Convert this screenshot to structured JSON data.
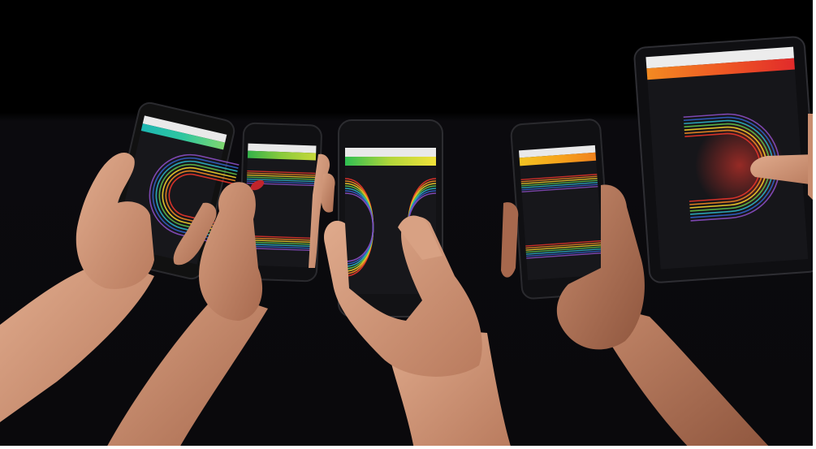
{
  "scene": {
    "background_top": "#000000",
    "background_bottom": "#0c0b10",
    "skin_colors": [
      "#d9a182",
      "#c98e70",
      "#b87a5e",
      "#a8684d"
    ],
    "nail_polish": "#c1242b"
  },
  "devices": [
    {
      "kind": "phone",
      "bar_gradient": [
        "#1db6b3",
        "#2ec7a0",
        "#7fd66e"
      ]
    },
    {
      "kind": "phone",
      "bar_gradient": [
        "#34b24a",
        "#8acb3c",
        "#c7d83a"
      ]
    },
    {
      "kind": "phone",
      "bar_gradient": [
        "#2fbf52",
        "#b3d63a",
        "#f1e23a"
      ]
    },
    {
      "kind": "phone",
      "bar_gradient": [
        "#f2c323",
        "#f7a51c",
        "#f0821d"
      ]
    },
    {
      "kind": "tablet",
      "bar_gradient": [
        "#f28a22",
        "#ef5a24",
        "#e12a2a"
      ]
    }
  ],
  "rainbow": [
    "#e8342b",
    "#f08a24",
    "#f3d12a",
    "#5fc049",
    "#2bb3c6",
    "#3160c8",
    "#8a4cc2"
  ]
}
